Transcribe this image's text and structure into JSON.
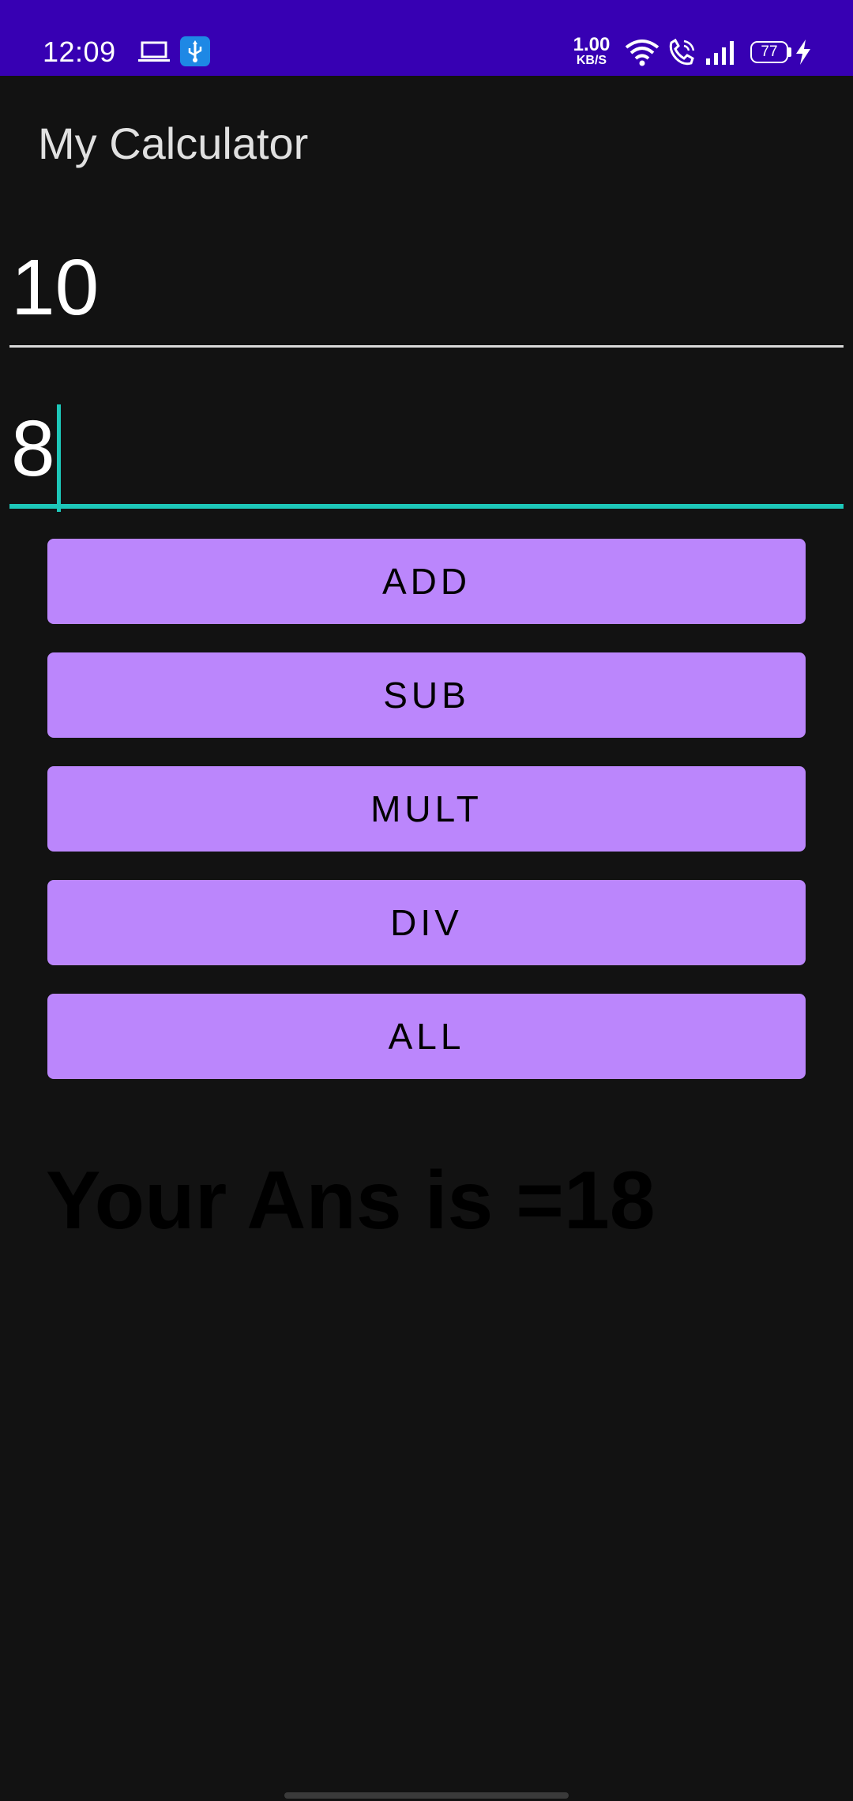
{
  "status_bar": {
    "time": "12:09",
    "network_speed_value": "1.00",
    "network_speed_unit": "KB/S",
    "battery_level": "77",
    "background_color": "#3700B3",
    "icons": [
      "laptop-icon",
      "usb-debug-icon",
      "wifi-icon",
      "wifi-calling-icon",
      "signal-icon",
      "battery-icon",
      "charging-icon"
    ]
  },
  "app_bar": {
    "title": "My Calculator"
  },
  "inputs": {
    "first_number": "10",
    "second_number": "8"
  },
  "buttons": {
    "add": "ADD",
    "sub": "SUB",
    "mult": "MULT",
    "div": "DIV",
    "all": "ALL"
  },
  "result": {
    "text": "Your Ans is =18"
  },
  "colors": {
    "background": "#121212",
    "button": "#BB86FC",
    "accent": "#1DC7B9",
    "status_bar": "#3700B3"
  }
}
